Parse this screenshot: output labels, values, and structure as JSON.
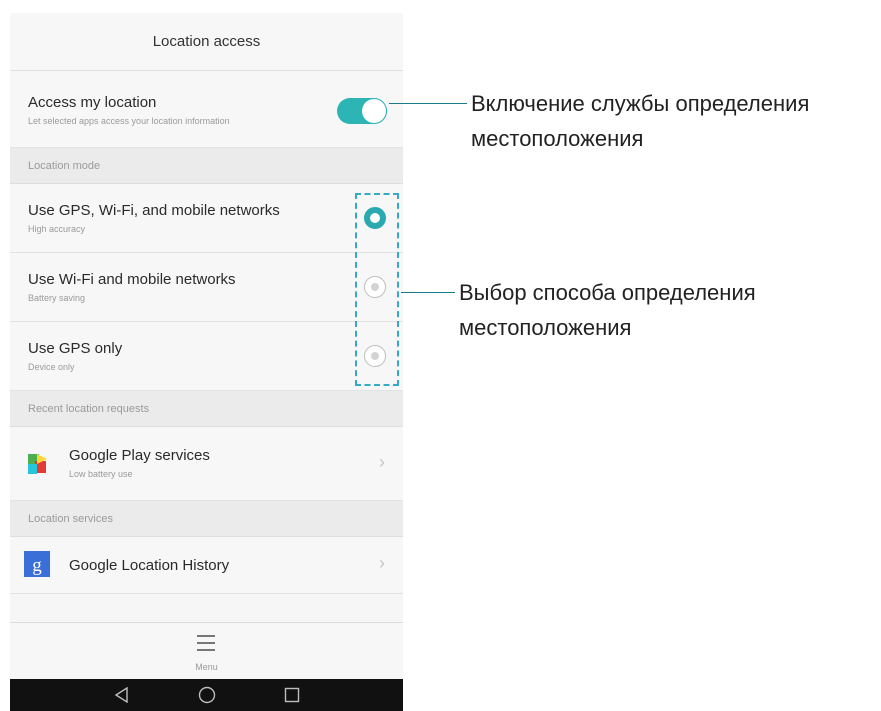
{
  "header": {
    "title": "Location access"
  },
  "access_location": {
    "title": "Access my location",
    "subtitle": "Let selected apps access your location information",
    "toggle_on": true
  },
  "location_mode": {
    "section_label": "Location mode",
    "options": [
      {
        "title": "Use GPS, Wi-Fi, and mobile networks",
        "subtitle": "High accuracy",
        "selected": true
      },
      {
        "title": "Use Wi-Fi and mobile networks",
        "subtitle": "Battery saving",
        "selected": false
      },
      {
        "title": "Use GPS only",
        "subtitle": "Device only",
        "selected": false
      }
    ]
  },
  "recent_requests": {
    "section_label": "Recent location requests",
    "items": [
      {
        "title": "Google Play services",
        "subtitle": "Low battery use",
        "icon": "google-play-services-icon"
      }
    ]
  },
  "location_services": {
    "section_label": "Location services",
    "items": [
      {
        "title": "Google Location History",
        "icon": "google-settings-icon"
      }
    ]
  },
  "bottom_menu": {
    "label": "Menu"
  },
  "navigation_bar": {
    "buttons": [
      "back-icon",
      "home-icon",
      "recents-icon"
    ]
  },
  "callouts": {
    "toggle_line1": "Включение службы определения",
    "toggle_line2": "местоположения",
    "mode_line1": "Выбор способа определения",
    "mode_line2": "местоположения"
  },
  "colors": {
    "accent": "#2db4b4",
    "callout_line": "#1a7a86",
    "dashed_box": "#36a9c9"
  }
}
